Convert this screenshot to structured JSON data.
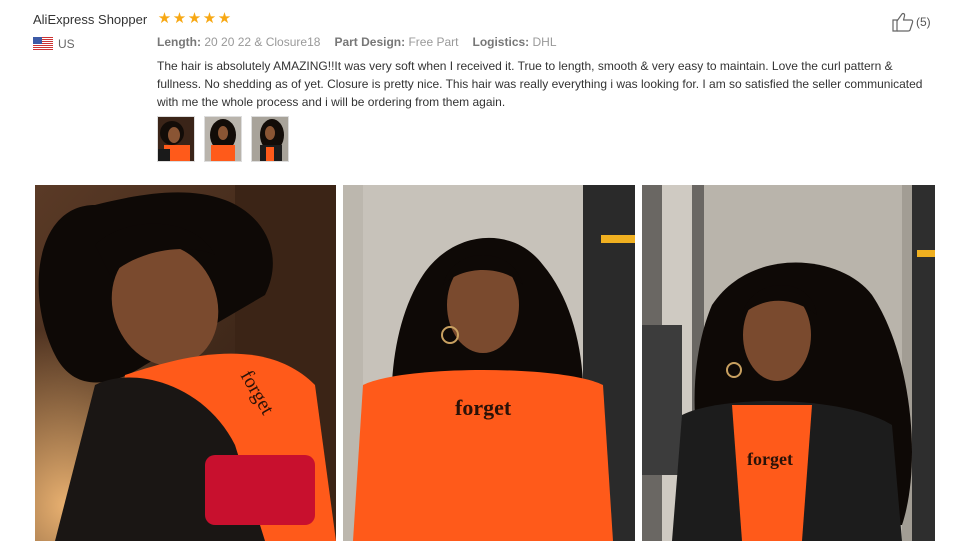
{
  "review": {
    "reviewer": "AliExpress Shopper",
    "rating": 5,
    "country": "US",
    "meta": [
      {
        "key": "Length:",
        "value": "20 20 22 & Closure18"
      },
      {
        "key": "Part Design:",
        "value": "Free Part"
      },
      {
        "key": "Logistics:",
        "value": "DHL"
      }
    ],
    "text": "The hair is absolutely AMAZING!!It was very soft when I received it. True to length, smooth & very easy to maintain. Love the curl pattern & fullness. No shedding as of yet. Closure is pretty nice. This hair was really everything i was looking for. I am so satisfied the seller communicated with me the whole process and i will be ordering from them again.",
    "likes": "(5)",
    "thumbnails": 3,
    "photos": 3
  },
  "colors": {
    "star": "#f7a814",
    "shirt": "#ff5a1a"
  },
  "photo_text": {
    "shirt_print": "forget"
  },
  "icons": [
    "star-icon",
    "us-flag-icon",
    "thumbs-up-icon"
  ]
}
